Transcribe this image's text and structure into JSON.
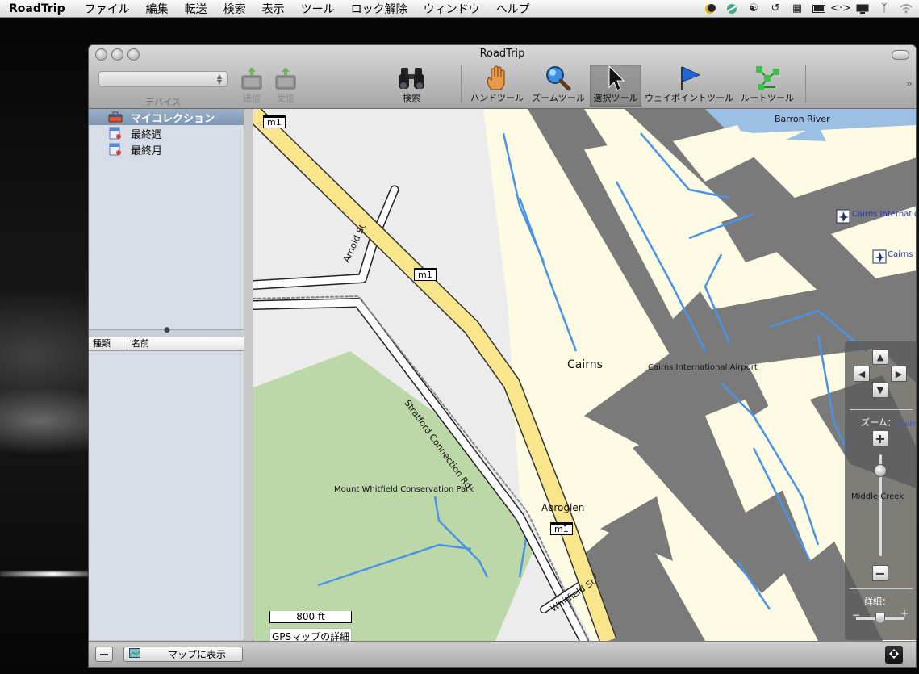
{
  "menubar": {
    "app_name": "RoadTrip",
    "items": [
      "ファイル",
      "編集",
      "転送",
      "検索",
      "表示",
      "ツール",
      "ロック解除",
      "ウィンドウ",
      "ヘルプ"
    ]
  },
  "window": {
    "title": "RoadTrip",
    "device_label": "デバイス",
    "device_value": ""
  },
  "toolbar": {
    "send_label": "送信",
    "receive_label": "受信",
    "search_label": "検索",
    "hand_tool_label": "ハンドツール",
    "zoom_tool_label": "ズームツール",
    "select_tool_label": "選択ツール",
    "waypoint_tool_label": "ウェイポイントツール",
    "route_tool_label": "ルートツール"
  },
  "sidebar": {
    "collections": [
      {
        "label": "マイコレクション",
        "selected": true
      },
      {
        "label": "最終週",
        "selected": false
      },
      {
        "label": "最終月",
        "selected": false
      }
    ],
    "table_headers": [
      "種類",
      "名前"
    ]
  },
  "bottombar": {
    "show_on_map_label": "マップに表示"
  },
  "map": {
    "labels": {
      "barron_river": "Barron River",
      "cairns_intl_1": "Cairns Internation",
      "cairns_intl_2": "Cairns In",
      "cairns": "Cairns",
      "cairns_airport": "Cairns International Airport",
      "arnold_st": "Arnold St",
      "stratford": "Stratford Connection Rd",
      "mount_whitfield": "Mount Whitfield Conservation Park",
      "aeroglen": "Aeroglen",
      "whitfield_st": "Whitfield St",
      "middle_creek": "Middle Creek",
      "cairns_overlay": "Cairns"
    },
    "shields": [
      "m1",
      "m1",
      "m1"
    ],
    "scale_label": "800 ft",
    "detail_caption": "GPSマップの詳細",
    "nav": {
      "zoom_label": "ズーム：",
      "detail_label": "詳細："
    }
  }
}
